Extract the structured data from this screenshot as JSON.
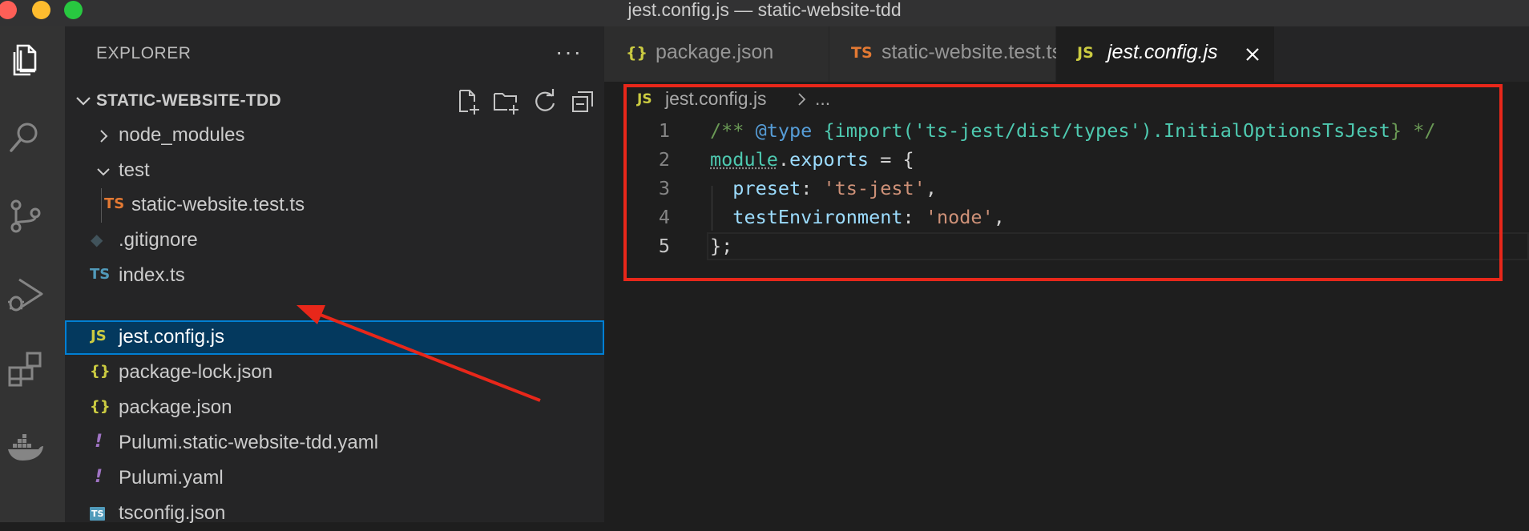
{
  "window": {
    "title": "jest.config.js — static-website-tdd"
  },
  "activity_bar": [
    "explorer",
    "search",
    "source-control",
    "run-and-debug",
    "extensions",
    "docker"
  ],
  "sidebar": {
    "title": "EXPLORER",
    "more": "···",
    "project": {
      "name": "STATIC-WEBSITE-TDD"
    },
    "items": [
      {
        "label": "node_modules",
        "icon": "chevron-right"
      },
      {
        "label": "test",
        "icon": "chevron-down"
      },
      {
        "label": "static-website.test.ts",
        "icon_text": "TS"
      },
      {
        "label": ".gitignore",
        "icon_text": "◆"
      },
      {
        "label": "index.ts",
        "icon_text": "TS"
      },
      {
        "label": "jest.config.js",
        "icon_text": "JS"
      },
      {
        "label": "package-lock.json",
        "icon_text": "{}"
      },
      {
        "label": "package.json",
        "icon_text": "{}"
      },
      {
        "label": "Pulumi.static-website-tdd.yaml",
        "icon_text": "!"
      },
      {
        "label": "Pulumi.yaml",
        "icon_text": "!"
      },
      {
        "label": "tsconfig.json",
        "icon_text": "TS"
      }
    ]
  },
  "tabs": [
    {
      "label": "package.json",
      "icon_text": "{}"
    },
    {
      "label": "static-website.test.ts",
      "icon_text": "TS"
    },
    {
      "label": "jest.config.js",
      "icon_text": "JS",
      "active": true
    }
  ],
  "breadcrumb": {
    "icon_text": "JS",
    "file": "jest.config.js",
    "more": "..."
  },
  "editor": {
    "line_numbers": [
      "1",
      "2",
      "3",
      "4",
      "5"
    ],
    "lines": {
      "l1": {
        "open": "/** ",
        "tag": "@type",
        "type": " {import('ts-jest/dist/types').",
        "typename": "InitialOptionsTsJest",
        "close": "} */"
      },
      "l2": {
        "module": "module",
        "dot": ".",
        "exports": "exports",
        "rest": " = {"
      },
      "l3": {
        "indent": "  ",
        "key": "preset",
        "colon": ": ",
        "value": "'ts-jest'",
        "comma": ","
      },
      "l4": {
        "indent": "  ",
        "key": "testEnvironment",
        "colon": ": ",
        "value": "'node'",
        "comma": ","
      },
      "l5": {
        "text": "};"
      }
    }
  },
  "colors": {
    "annotation_red": "#e8271a",
    "selection": "#04395e",
    "ts_blue": "#519aba",
    "ts_orange": "#e37933",
    "js_yellow": "#cbcb41",
    "yaml_purple": "#a074c4"
  }
}
